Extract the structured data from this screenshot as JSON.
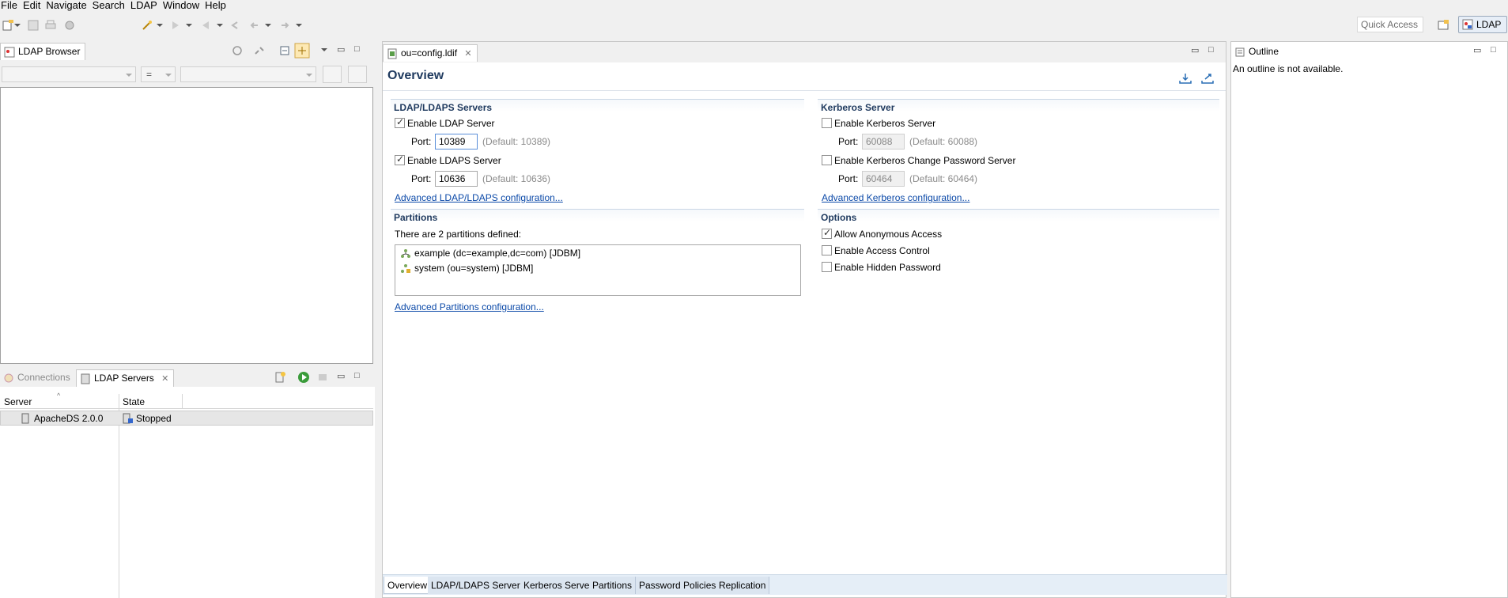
{
  "menu": [
    "File",
    "Edit",
    "Navigate",
    "Search",
    "LDAP",
    "Window",
    "Help"
  ],
  "toolbar": {
    "quick_access": "Quick Access",
    "perspective": "LDAP"
  },
  "ldap_browser": {
    "tab_label": "LDAP Browser",
    "filter_operator": "="
  },
  "servers_view": {
    "tabs": [
      "Connections",
      "LDAP Servers"
    ],
    "columns": [
      "Server",
      "State"
    ],
    "rows": [
      {
        "server": "ApacheDS 2.0.0",
        "state": "Stopped"
      }
    ]
  },
  "editor": {
    "tab_label": "ou=config.ldif",
    "title": "Overview",
    "ldap_section": {
      "title": "LDAP/LDAPS Servers",
      "enable_ldap_label": "Enable LDAP Server",
      "enable_ldap_checked": true,
      "ldap_port_label": "Port:",
      "ldap_port": "10389",
      "ldap_port_default": "(Default: 10389)",
      "enable_ldaps_label": "Enable LDAPS Server",
      "enable_ldaps_checked": true,
      "ldaps_port_label": "Port:",
      "ldaps_port": "10636",
      "ldaps_port_default": "(Default: 10636)",
      "advanced_link": "Advanced LDAP/LDAPS configuration..."
    },
    "kerberos_section": {
      "title": "Kerberos Server",
      "enable_kerberos_label": "Enable Kerberos Server",
      "enable_kerberos_checked": false,
      "kerberos_port_label": "Port:",
      "kerberos_port": "60088",
      "kerberos_port_default": "(Default: 60088)",
      "enable_change_pw_label": "Enable Kerberos Change Password Server",
      "enable_change_pw_checked": false,
      "change_pw_port_label": "Port:",
      "change_pw_port": "60464",
      "change_pw_port_default": "(Default: 60464)",
      "advanced_link": "Advanced Kerberos configuration..."
    },
    "partitions_section": {
      "title": "Partitions",
      "summary": "There are 2 partitions defined:",
      "items": [
        "example (dc=example,dc=com) [JDBM]",
        "system (ou=system) [JDBM]"
      ],
      "advanced_link": "Advanced Partitions configuration..."
    },
    "options_section": {
      "title": "Options",
      "allow_anonymous_label": "Allow Anonymous Access",
      "allow_anonymous_checked": true,
      "access_control_label": "Enable Access Control",
      "access_control_checked": false,
      "hidden_password_label": "Enable Hidden Password",
      "hidden_password_checked": false
    },
    "bottom_tabs": [
      "Overview",
      "LDAP/LDAPS Servers",
      "Kerberos Server",
      "Partitions",
      "Password Policies",
      "Replication"
    ]
  },
  "outline": {
    "tab_label": "Outline",
    "message": "An outline is not available."
  }
}
